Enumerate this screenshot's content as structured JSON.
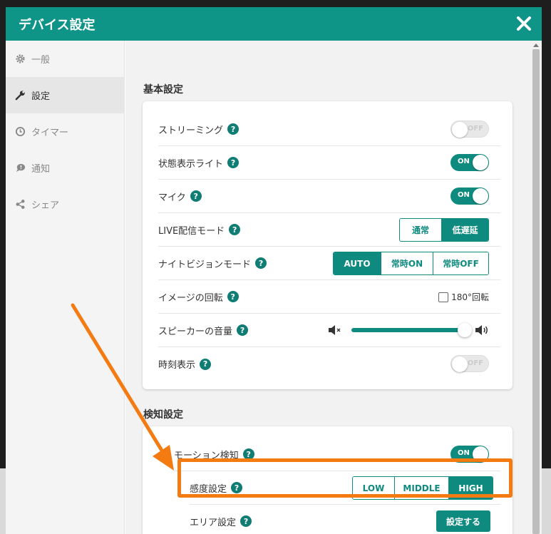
{
  "dialog": {
    "title": "デバイス設定",
    "close_icon": "close-icon"
  },
  "sidebar": {
    "items": [
      {
        "label": "一般",
        "icon": "gear-icon",
        "active": false
      },
      {
        "label": "設定",
        "icon": "wrench-icon",
        "active": true
      },
      {
        "label": "タイマー",
        "icon": "clock-icon",
        "active": false
      },
      {
        "label": "通知",
        "icon": "speech-bubble-icon",
        "active": false
      },
      {
        "label": "シェア",
        "icon": "share-icon",
        "active": false
      }
    ]
  },
  "basic": {
    "section_title": "基本設定",
    "streaming": {
      "label": "ストリーミング",
      "toggle": "OFF"
    },
    "status_light": {
      "label": "状態表示ライト",
      "toggle": "ON"
    },
    "mic": {
      "label": "マイク",
      "toggle": "ON"
    },
    "live_mode": {
      "label": "LIVE配信モード",
      "options": [
        "通常",
        "低遅延"
      ],
      "selected": "低遅延"
    },
    "night_vision": {
      "label": "ナイトビジョンモード",
      "options": [
        "AUTO",
        "常時ON",
        "常時OFF"
      ],
      "selected": "AUTO"
    },
    "rotation": {
      "label": "イメージの回転",
      "checkbox_label": "180°回転",
      "checked": false
    },
    "speaker": {
      "label": "スピーカーの音量",
      "volume_percent": 100,
      "mute_icon": "volume-mute-icon",
      "max_icon": "volume-up-icon"
    },
    "time_display": {
      "label": "時刻表示",
      "toggle": "OFF"
    },
    "help_text": "?"
  },
  "detection": {
    "section_title": "検知設定",
    "motion": {
      "label": "モーション検知",
      "toggle": "ON"
    },
    "sensitivity": {
      "label": "感度設定",
      "options": [
        "LOW",
        "MIDDLE",
        "HIGH"
      ],
      "selected": "HIGH"
    },
    "area": {
      "label": "エリア設定",
      "button_label": "設定する"
    }
  },
  "colors": {
    "accent": "#0f8a7e",
    "header": "#0f9488",
    "annotation": "#f47a12"
  }
}
